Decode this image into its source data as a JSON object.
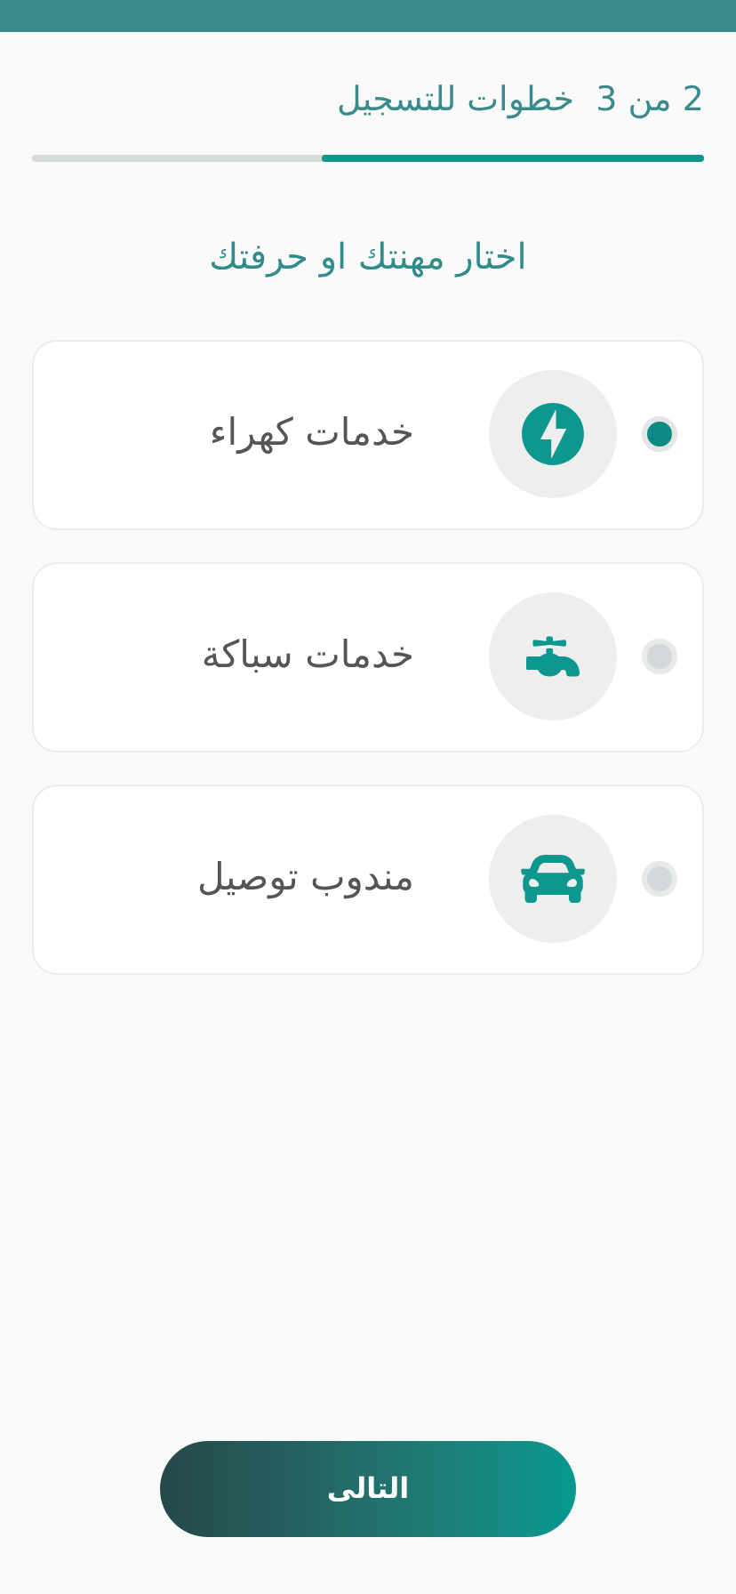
{
  "header": {
    "step_text": "2 من 3  خطوات للتسجيل",
    "progress": {
      "level": 0.57
    }
  },
  "title": "اختار مهنتك او حرفتك",
  "options": [
    {
      "label": "خدمات كهراء",
      "kind": "electric",
      "selected": true
    },
    {
      "label": "خدمات سباكة",
      "kind": "plumbing",
      "selected": false
    },
    {
      "label": "مندوب توصيل",
      "kind": "delivery",
      "selected": false
    }
  ],
  "next_button": "التالى"
}
